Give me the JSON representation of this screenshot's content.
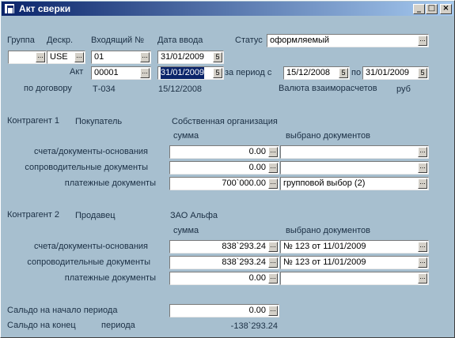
{
  "window": {
    "title": "Акт сверки",
    "minimize": "_",
    "maximize": "□",
    "close": "×"
  },
  "header": {
    "group_label": "Группа",
    "group_value": "",
    "descr_label": "Дескр.",
    "descr_value": "USE",
    "incoming_label": "Входящий №",
    "incoming_value": "01",
    "entry_date_label": "Дата ввода",
    "entry_date_value": "31/01/2009",
    "status_label": "Статус",
    "status_value": "оформляемый",
    "act_label": "Акт",
    "act_value": "00001",
    "act_date_value": "31/01/2009",
    "period_label": "за период с",
    "period_from": "15/12/2008",
    "period_to_label": "по",
    "period_to": "31/01/2009",
    "contract_label": "по договору",
    "contract_value": "Т-034",
    "contract_date": "15/12/2008",
    "currency_label": "Валюта взаиморасчетов",
    "currency_value": "руб"
  },
  "contractor1": {
    "label": "Контрагент 1",
    "role": "Покупатель",
    "name": "Собственная организация",
    "col_sum": "сумма",
    "col_docs": "выбрано документов",
    "rows": [
      {
        "label": "счета/документы-основания",
        "sum": "0.00",
        "docs": ""
      },
      {
        "label": "сопроводительные документы",
        "sum": "0.00",
        "docs": ""
      },
      {
        "label": "платежные документы",
        "sum": "700`000.00",
        "docs": "групповой выбор (2)"
      }
    ]
  },
  "contractor2": {
    "label": "Контрагент 2",
    "role": "Продавец",
    "name": "ЗАО Альфа",
    "col_sum": "сумма",
    "col_docs": "выбрано документов",
    "rows": [
      {
        "label": "счета/документы-основания",
        "sum": "838`293.24",
        "docs": "№ 123 от 11/01/2009"
      },
      {
        "label": "сопроводительные документы",
        "sum": "838`293.24",
        "docs": "№ 123 от 11/01/2009"
      },
      {
        "label": "платежные документы",
        "sum": "0.00",
        "docs": ""
      }
    ]
  },
  "balance": {
    "start_label": "Сальдо на начало периода",
    "start_value": "0.00",
    "end_label": "Сальдо на конец",
    "end_period_label": "периода",
    "end_value": "-138`293.24"
  },
  "buttons": {
    "dots": "...",
    "calendar": "5"
  }
}
